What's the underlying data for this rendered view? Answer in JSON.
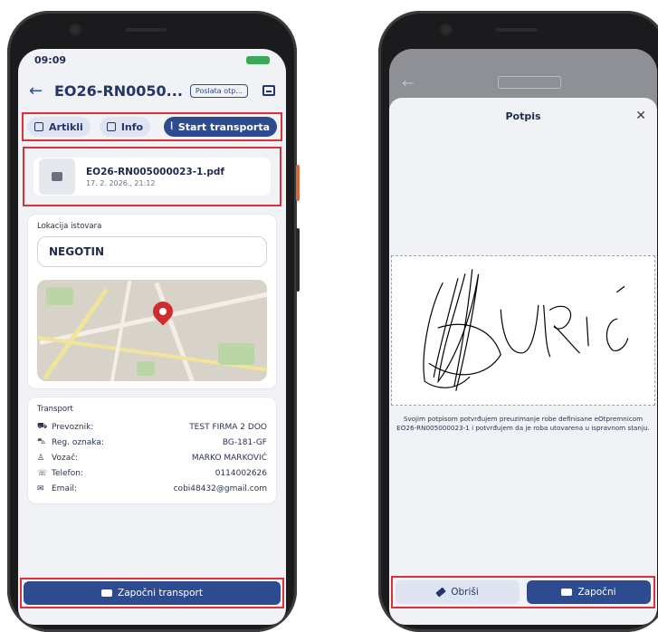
{
  "left_screen": {
    "status_time": "09:09",
    "header": {
      "title": "EO26-RN0050...",
      "status": "Poslata otp..."
    },
    "tabs": [
      {
        "label": "Artikli"
      },
      {
        "label": "Info"
      },
      {
        "label": "Start transporta"
      }
    ],
    "attachment": {
      "name": "EO26-RN005000023-1.pdf",
      "date": "17. 2. 2026., 21:12"
    },
    "location": {
      "label": "Lokacija istovara",
      "value": "NEGOTIN"
    },
    "transport": {
      "label": "Transport",
      "rows": [
        {
          "key": "Prevoznik:",
          "value": "TEST FIRMA 2 DOO",
          "icon": "truck-icon"
        },
        {
          "key": "Reg. oznaka:",
          "value": "BG-181-GF",
          "icon": "car-icon"
        },
        {
          "key": "Vozač:",
          "value": "MARKO MARKOVIĆ",
          "icon": "user-icon"
        },
        {
          "key": "Telefon:",
          "value": "0114002626",
          "icon": "phone-icon"
        },
        {
          "key": "Email:",
          "value": "cobi48432@gmail.com",
          "icon": "mail-icon"
        }
      ]
    },
    "start_button": "Započni transport"
  },
  "right_screen": {
    "title": "Potpis",
    "consent": "Svojim potpisom potvrđujem preuzimanje robe definisane eOtpremnicom EO26-RN005000023-1 i potvrđujem da je roba utovarena u ispravnom stanju.",
    "clear_button": "Obriši",
    "start_button": "Započni"
  },
  "colors": {
    "primary": "#2f4b8f",
    "highlight": "#d8323a",
    "chip": "#dfe4f2"
  }
}
